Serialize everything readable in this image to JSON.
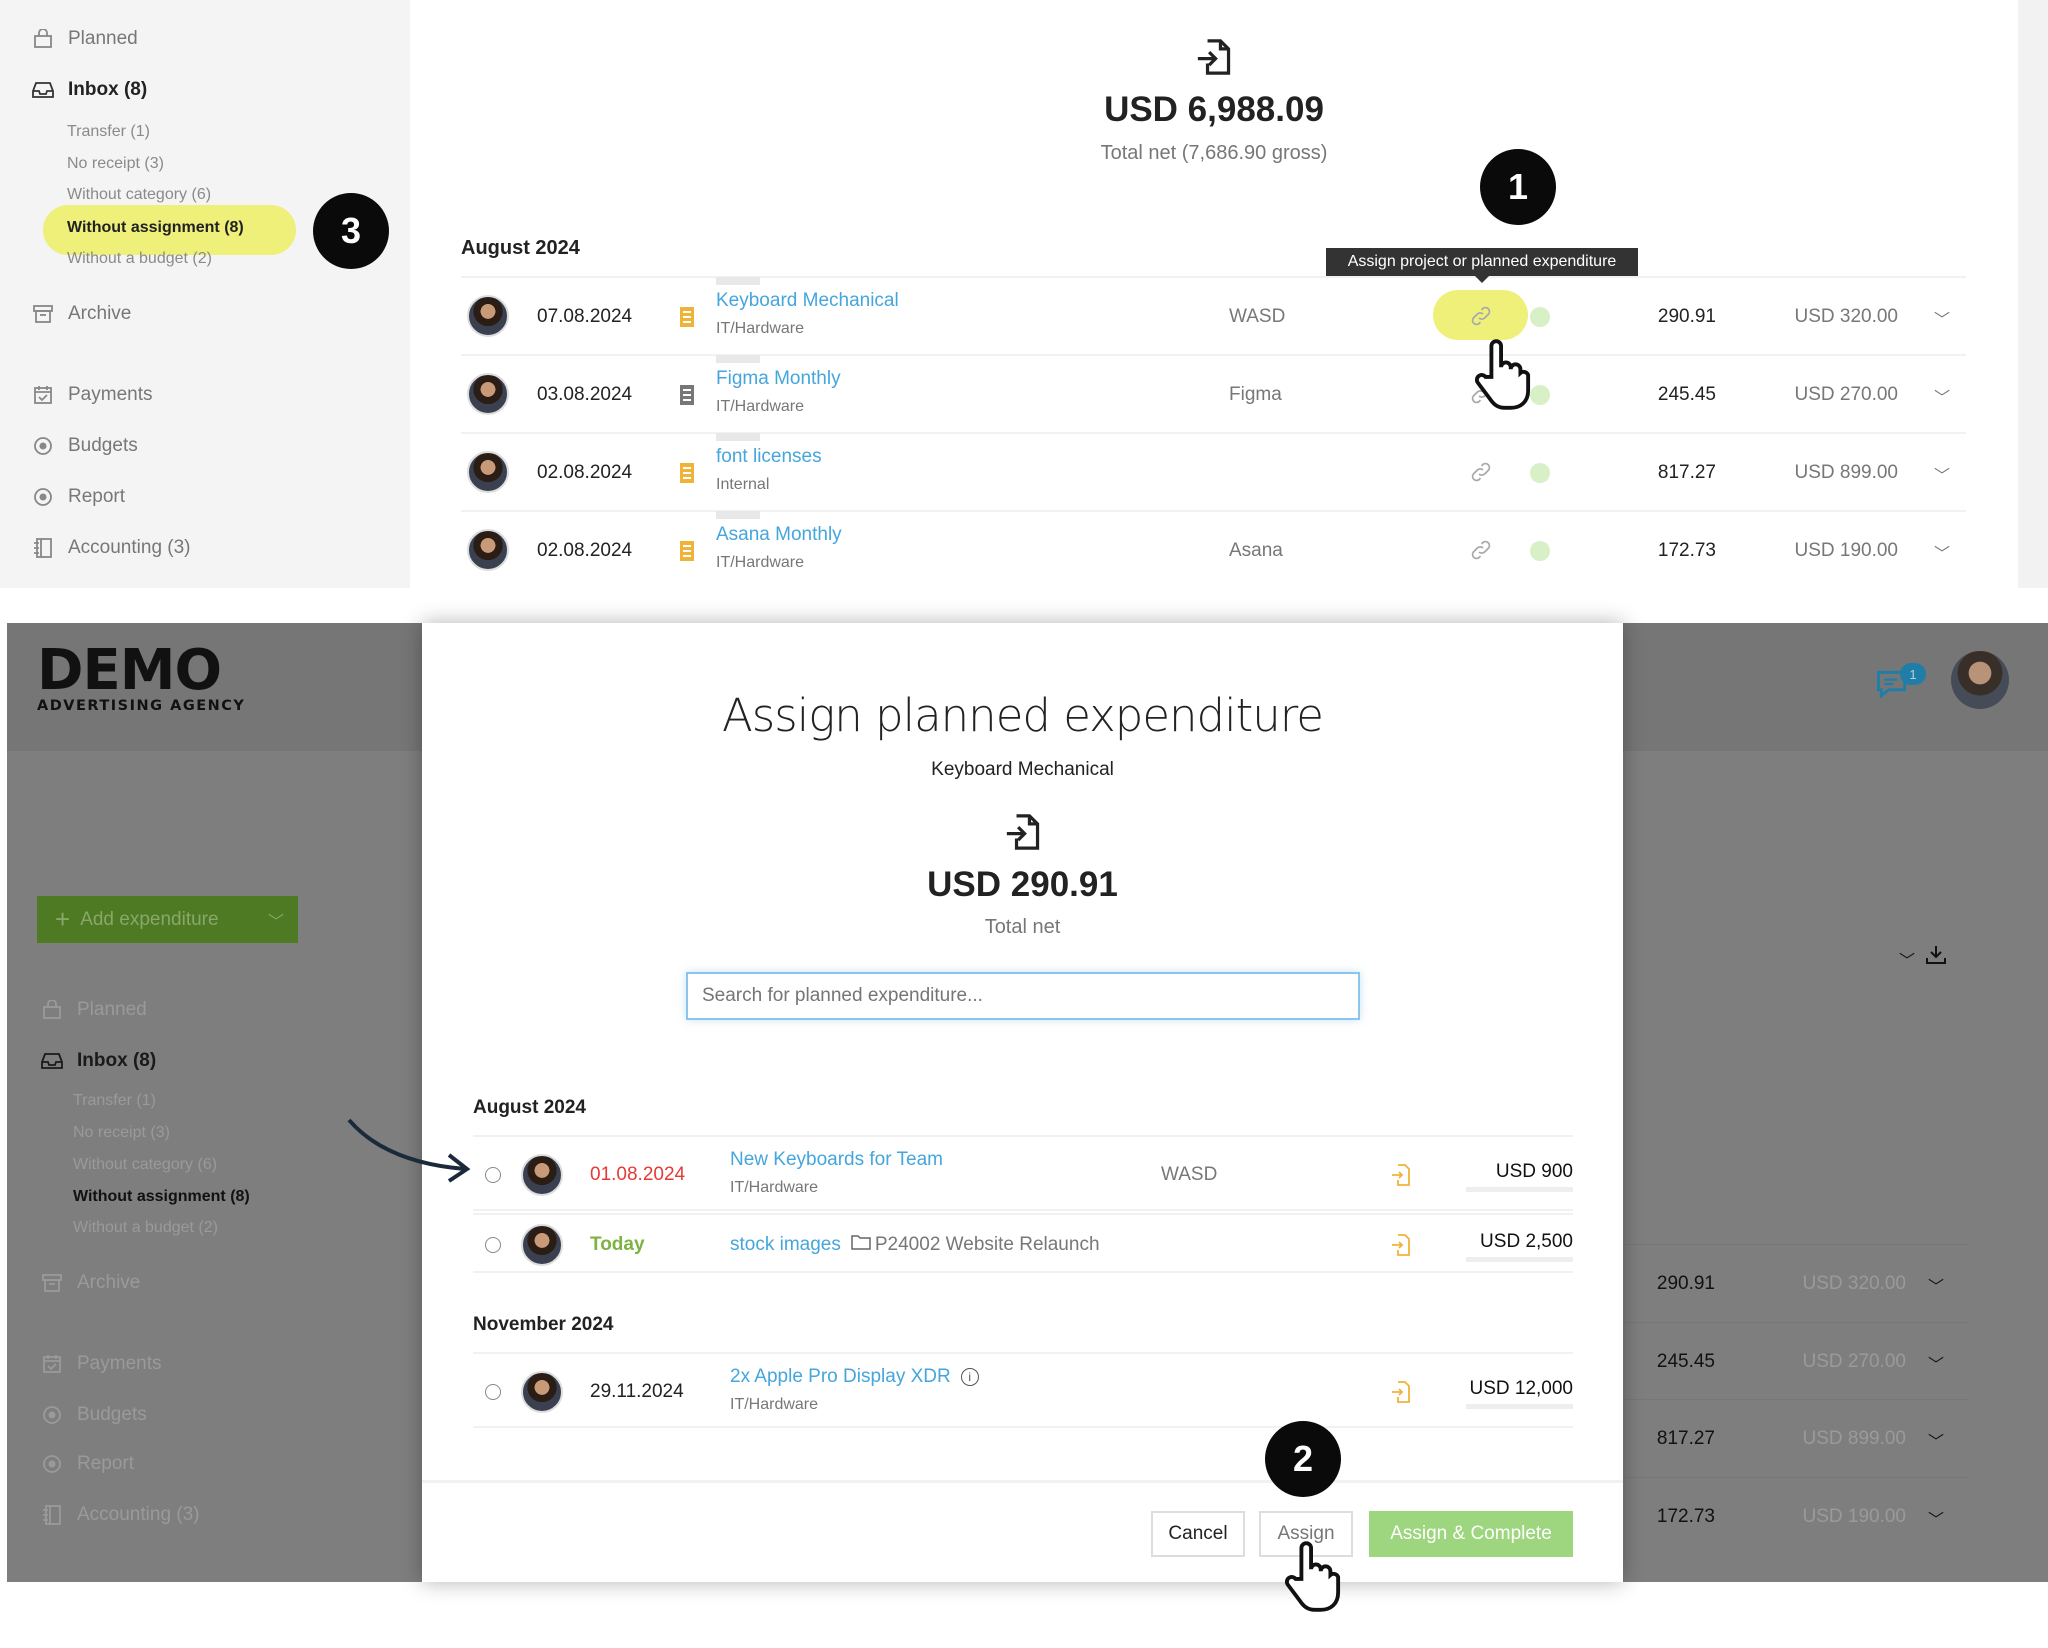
{
  "top": {
    "sidebar": {
      "items": [
        {
          "label": "Planned",
          "icon": "bag-icon"
        },
        {
          "label": "Inbox (8)",
          "icon": "inbox-icon"
        },
        {
          "label": "Archive",
          "icon": "archive-icon"
        },
        {
          "label": "Payments",
          "icon": "calendar-check-icon"
        },
        {
          "label": "Budgets",
          "icon": "target-icon"
        },
        {
          "label": "Report",
          "icon": "target-icon"
        },
        {
          "label": "Accounting (3)",
          "icon": "ledger-icon"
        }
      ],
      "subitems": [
        "Transfer (1)",
        "No receipt (3)",
        "Without category (6)",
        "Without assignment (8)",
        "Without a budget (2)"
      ]
    },
    "summary": {
      "total": "USD 6,988.09",
      "caption": "Total net (7,686.90 gross)",
      "icon": "file-import-icon"
    },
    "section": "August 2024",
    "tooltip": "Assign project or planned expenditure",
    "rows": [
      {
        "date": "07.08.2024",
        "receipt": "orange",
        "title": "Keyboard Mechanical",
        "category": "IT/Hardware",
        "vendor": "WASD",
        "net": "290.91",
        "gross": "USD 320.00"
      },
      {
        "date": "03.08.2024",
        "receipt": "gray",
        "title": "Figma Monthly",
        "category": "IT/Hardware",
        "vendor": "Figma",
        "net": "245.45",
        "gross": "USD 270.00"
      },
      {
        "date": "02.08.2024",
        "receipt": "orange",
        "title": "font licenses",
        "category": "Internal",
        "vendor": "",
        "net": "817.27",
        "gross": "USD 899.00"
      },
      {
        "date": "02.08.2024",
        "receipt": "orange",
        "title": "Asana Monthly",
        "category": "IT/Hardware",
        "vendor": "Asana",
        "net": "172.73",
        "gross": "USD 190.00"
      }
    ]
  },
  "steps": {
    "one": "1",
    "two": "2",
    "three": "3"
  },
  "bottom": {
    "logo": {
      "main": "DEMO",
      "sub": "ADVERTISING AGENCY"
    },
    "add_expenditure": "Add expenditure",
    "chat_badge": "1",
    "sidebar": {
      "items": [
        "Planned",
        "Inbox (8)",
        "Archive",
        "Payments",
        "Budgets",
        "Report",
        "Accounting (3)"
      ],
      "subitems": [
        "Transfer (1)",
        "No receipt (3)",
        "Without category (6)",
        "Without assignment (8)",
        "Without a budget (2)"
      ]
    },
    "rows": [
      {
        "net": "290.91",
        "gross": "USD 320.00"
      },
      {
        "net": "245.45",
        "gross": "USD 270.00"
      },
      {
        "net": "817.27",
        "gross": "USD 899.00"
      },
      {
        "net": "172.73",
        "gross": "USD 190.00"
      }
    ]
  },
  "modal": {
    "title": "Assign planned expenditure",
    "subtitle": "Keyboard Mechanical",
    "amount": "USD 290.91",
    "caption": "Total net",
    "search_placeholder": "Search for planned expenditure...",
    "groups": [
      {
        "label": "August 2024",
        "rows": [
          {
            "date": "01.08.2024",
            "date_color": "#e53935",
            "title": "New Keyboards for Team",
            "category": "IT/Hardware",
            "project": "",
            "vendor": "WASD",
            "amount": "USD 900"
          },
          {
            "date": "Today",
            "date_color": "#7cb342",
            "title": "stock images",
            "category": "",
            "project": "P24002 Website Relaunch",
            "vendor": "",
            "amount": "USD 2,500"
          }
        ]
      },
      {
        "label": "November 2024",
        "rows": [
          {
            "date": "29.11.2024",
            "date_color": "#222222",
            "title": "2x Apple Pro Display XDR",
            "category": "IT/Hardware",
            "project": "",
            "vendor": "",
            "amount": "USD 12,000",
            "info": true
          }
        ]
      }
    ],
    "buttons": {
      "cancel": "Cancel",
      "assign": "Assign",
      "assign_complete": "Assign & Complete"
    }
  },
  "colors": {
    "link": "#45a6dc",
    "highlight": "#eef07a",
    "green": "#8fcf6a",
    "receipt": "#f0b33a",
    "status_dot": "#d7f0c6"
  }
}
